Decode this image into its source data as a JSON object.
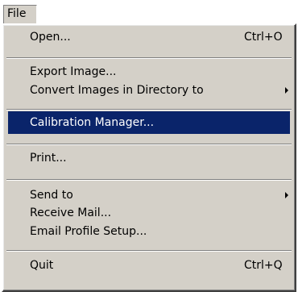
{
  "menubar": {
    "file_label": "File"
  },
  "menu": {
    "open_label": "Open...",
    "open_shortcut": "Ctrl+O",
    "export_label": "Export Image...",
    "convert_label": "Convert Images in Directory to",
    "calibration_label": "Calibration Manager...",
    "print_label": "Print...",
    "sendto_label": "Send to",
    "receive_label": "Receive Mail...",
    "email_setup_label": "Email Profile Setup...",
    "quit_label": "Quit",
    "quit_shortcut": "Ctrl+Q"
  },
  "colors": {
    "menu_bg": "#d4d0c8",
    "highlight_bg": "#0a246a",
    "highlight_text": "#ffffff"
  }
}
